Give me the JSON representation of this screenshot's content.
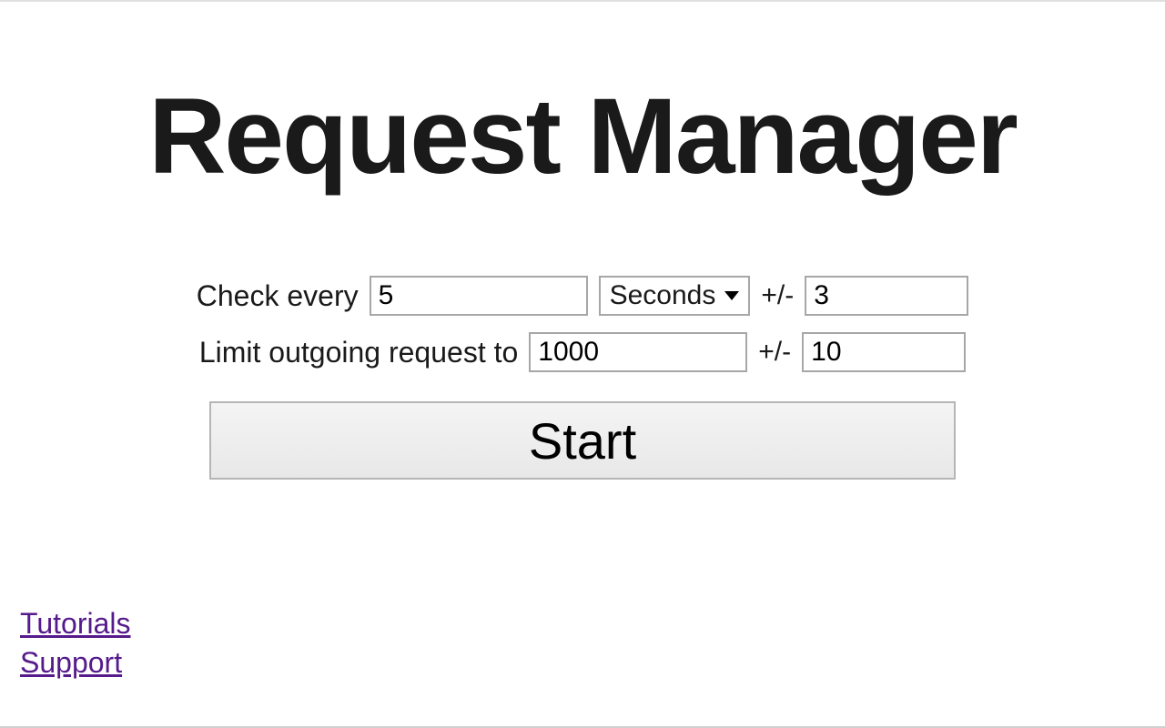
{
  "title": "Request Manager",
  "form": {
    "check_label_prefix": "Check every",
    "check_value": "5",
    "time_unit_selected": "Seconds",
    "check_variance": "3",
    "limit_label": "Limit outgoing request to",
    "limit_value": "1000",
    "limit_variance": "10",
    "plus_minus": "+/-",
    "start_label": "Start"
  },
  "links": {
    "tutorials": "Tutorials",
    "support": "Support"
  }
}
